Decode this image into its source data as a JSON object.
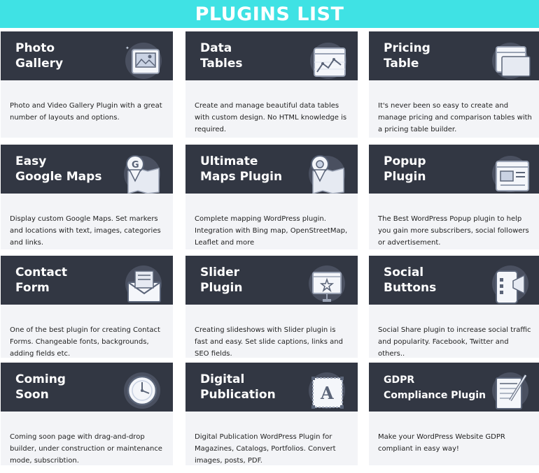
{
  "banner": {
    "title": "PLUGINS LIST"
  },
  "colors": {
    "accent": "#3fe2e4",
    "card_header": "#323743",
    "card_body": "#f3f4f7"
  },
  "plugins": [
    {
      "title": "Photo\nGallery",
      "icon": "photo-gallery-icon",
      "description": "Photo and Video Gallery Plugin with a great number of layouts and options."
    },
    {
      "title": "Data\nTables",
      "icon": "data-tables-icon",
      "description": "Create and manage beautiful data tables with custom design. No HTML knowledge is required."
    },
    {
      "title": "Pricing\nTable",
      "icon": "pricing-table-icon",
      "description": "It's never been so easy to create and manage pricing and comparison tables with a pricing table builder."
    },
    {
      "title": "Easy\nGoogle Maps",
      "icon": "google-maps-icon",
      "description": "Display custom Google Maps. Set markers and locations with text, images, categories and links."
    },
    {
      "title": "Ultimate\nMaps Plugin",
      "icon": "maps-plugin-icon",
      "description": "Complete mapping WordPress plugin. Integration with Bing map, OpenStreetMap, Leaflet and more"
    },
    {
      "title": "Popup\nPlugin",
      "icon": "popup-icon",
      "description": "The Best WordPress Popup plugin to help you gain more subscribers, social followers or advertisement."
    },
    {
      "title": "Contact\nForm",
      "icon": "contact-form-icon",
      "description": "One of the best plugin for creating Contact Forms. Changeable fonts, backgrounds, adding fields etc."
    },
    {
      "title": "Slider\nPlugin",
      "icon": "slider-icon",
      "description": "Creating slideshows with Slider plugin is fast and easy. Set slide captions, links and SEO fields."
    },
    {
      "title": "Social\nButtons",
      "icon": "social-buttons-icon",
      "description": "Social Share plugin to increase social traffic and popularity. Facebook, Twitter and others.."
    },
    {
      "title": "Coming\nSoon",
      "icon": "coming-soon-icon",
      "description": "Coming soon page with drag-and-drop builder, under construction or maintenance mode, subscribtion."
    },
    {
      "title": "Digital\nPublication",
      "icon": "digital-publication-icon",
      "description": "Digital Publication WordPress Plugin for Magazines, Catalogs, Portfolios. Convert images, posts, PDF."
    },
    {
      "title": "GDPR\nCompliance Plugin",
      "icon": "gdpr-icon",
      "description": "Make your WordPress Website GDPR compliant in easy way!"
    }
  ]
}
